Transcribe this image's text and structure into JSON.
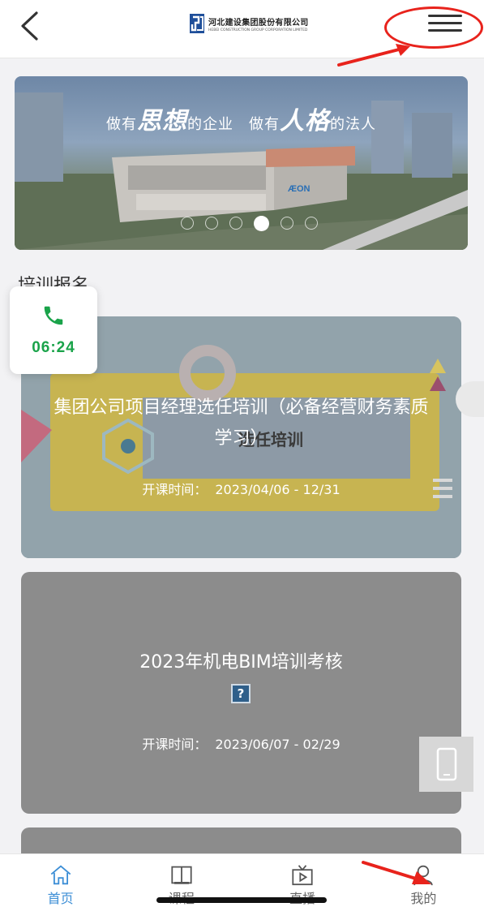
{
  "header": {
    "back_icon": "chevron-left-icon",
    "logo_cn": "河北建设集团股份有限公司",
    "logo_en": "HEBEI CONSTRUCTION GROUP CORPORATION LIMITED",
    "menu_icon": "hamburger-menu-icon"
  },
  "banner": {
    "slogan_part1": "做有",
    "slogan_big1": "思想",
    "slogan_part2": "的企业　做有",
    "slogan_big2": "人格",
    "slogan_part3": "的法人",
    "building_sign": "ÆON",
    "slide_count": 6,
    "active_slide": 4
  },
  "section": {
    "title": "培训报名"
  },
  "call": {
    "icon": "phone-icon",
    "time": "06:24",
    "color": "#1aa34a"
  },
  "courses": [
    {
      "title": "集团公司项目经理选任培训（必备经营财务素质学习）",
      "image_text": "选任培训",
      "date_label": "开课时间：",
      "date_range": "2023/04/06 - 12/31"
    },
    {
      "title": "2023年机电BIM培训考核",
      "image_placeholder": "?",
      "date_label": "开课时间：",
      "date_range": "2023/06/07 - 02/29"
    }
  ],
  "floating": {
    "icon": "mobile-phone-icon"
  },
  "nav": {
    "items": [
      {
        "label": "首页",
        "icon": "home-icon",
        "active": true
      },
      {
        "label": "课程",
        "icon": "book-icon",
        "active": false
      },
      {
        "label": "直播",
        "icon": "tv-icon",
        "active": false
      },
      {
        "label": "我的",
        "icon": "user-icon",
        "active": false
      }
    ]
  },
  "colors": {
    "accent": "#3c8ed6",
    "annotation": "#e8231c",
    "call_green": "#1aa34a"
  }
}
